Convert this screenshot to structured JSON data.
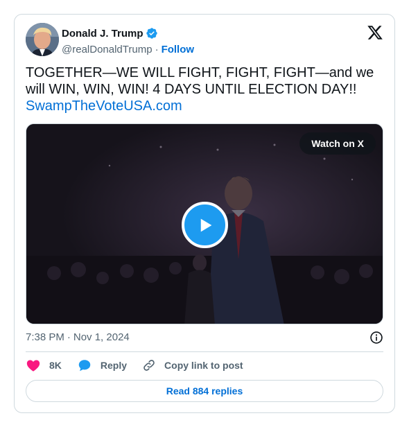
{
  "author": {
    "display_name": "Donald J. Trump",
    "handle": "@realDonaldTrump",
    "separator": "·",
    "follow_label": "Follow"
  },
  "tweet": {
    "text": "TOGETHER—WE WILL FIGHT, FIGHT, FIGHT—and we will WIN, WIN, WIN! 4 DAYS UNTIL ELECTION DAY!!",
    "link": "SwampTheVoteUSA.com"
  },
  "media": {
    "watch_label": "Watch on X"
  },
  "meta": {
    "time": "7:38 PM",
    "separator": "·",
    "date": "Nov 1, 2024"
  },
  "actions": {
    "likes": "8K",
    "reply_label": "Reply",
    "copy_label": "Copy link to post"
  },
  "footer": {
    "read_replies": "Read 884 replies"
  },
  "colors": {
    "accent": "#006fd6",
    "verified": "#1d9bf0",
    "like": "#f91880",
    "muted": "#536471"
  }
}
